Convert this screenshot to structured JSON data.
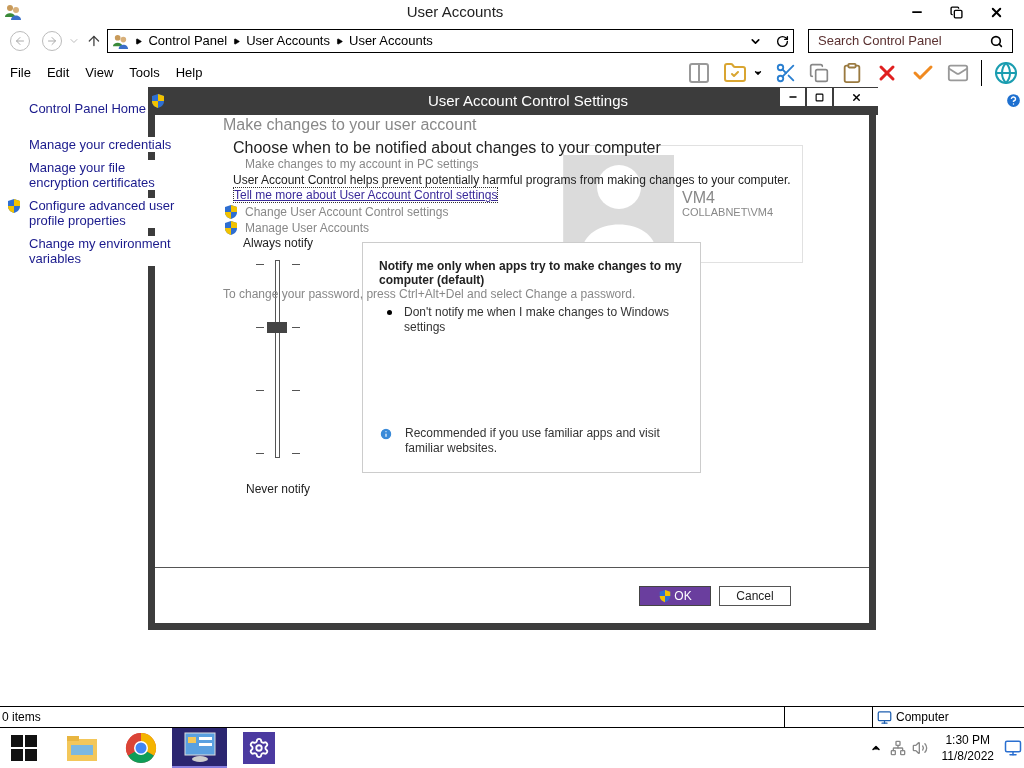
{
  "window": {
    "title": "User Accounts"
  },
  "address_bar": {
    "segments": [
      "Control Panel",
      "User Accounts",
      "User Accounts"
    ]
  },
  "search": {
    "placeholder": "Search Control Panel"
  },
  "menu": [
    "File",
    "Edit",
    "View",
    "Tools",
    "Help"
  ],
  "sidebar": {
    "items": [
      {
        "label": "Control Panel Home",
        "kind": "home"
      },
      {
        "label": "Manage your credentials",
        "kind": "link"
      },
      {
        "label": "Manage your file encryption certificates",
        "kind": "link"
      },
      {
        "label": "Configure advanced user profile properties",
        "kind": "shield"
      },
      {
        "label": "Change my environment variables",
        "kind": "link"
      }
    ]
  },
  "main": {
    "heading": "Make changes to your user account",
    "links": [
      {
        "label": "Make changes to my account in PC settings",
        "kind": "plain"
      },
      {
        "label": "Change User Account Control settings",
        "kind": "shield"
      },
      {
        "label": "Manage User Accounts",
        "kind": "shield"
      }
    ],
    "password_note": "To change your password, press Ctrl+Alt+Del and select Change a password.",
    "user": {
      "name": "VM4",
      "account": "COLLABNET\\VM4"
    }
  },
  "dialog": {
    "title": "User Account Control Settings",
    "heading": "Choose when to be notified about changes to your computer",
    "description": "User Account Control helps prevent potentially harmful programs from making changes to your computer.",
    "link": "Tell me more about User Account Control settings",
    "top_label": "Always notify",
    "bottom_label": "Never notify",
    "slider": {
      "level": 0.667
    },
    "detail": {
      "title": "Notify me only when apps try to make changes to my computer (default)",
      "bullets": [
        "Don't notify me when I make changes to Windows settings"
      ],
      "note": "Recommended if you use familiar apps and visit familiar websites."
    },
    "buttons": [
      {
        "label": "OK",
        "kind": "primary"
      },
      {
        "label": "Cancel",
        "kind": "secondary"
      }
    ]
  },
  "status_bar": {
    "items": "0 items",
    "location": "Computer"
  },
  "taskbar": {
    "apps": [
      {
        "kind": "explorer",
        "selected": false
      },
      {
        "kind": "chrome",
        "selected": false
      },
      {
        "kind": "control-panel",
        "selected": true
      },
      {
        "kind": "settings",
        "selected": false
      }
    ],
    "time": "1:30 PM",
    "date": "11/8/2022"
  }
}
